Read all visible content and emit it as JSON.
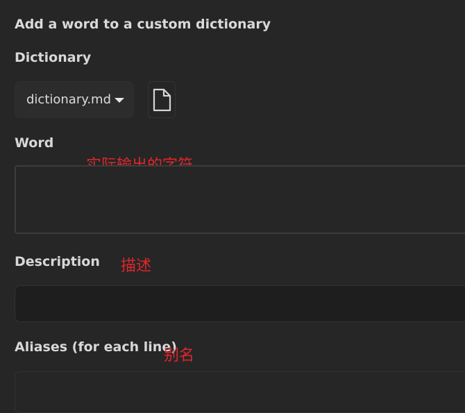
{
  "dialog": {
    "title": "Add a word to a custom dictionary"
  },
  "fields": {
    "dictionary": {
      "label": "Dictionary",
      "selected": "dictionary.md"
    },
    "word": {
      "label": "Word",
      "value": ""
    },
    "description": {
      "label": "Description",
      "value": ""
    },
    "aliases": {
      "label": "Aliases (for each line)",
      "value": ""
    }
  },
  "annotations": {
    "word_note": "实际输出的字符",
    "description_note": "描述",
    "aliases_note": "别名"
  },
  "icons": {
    "dropdown": "chevron-down-icon",
    "file": "file-icon"
  },
  "colors": {
    "background": "#262626",
    "annotation": "#e0262b"
  }
}
